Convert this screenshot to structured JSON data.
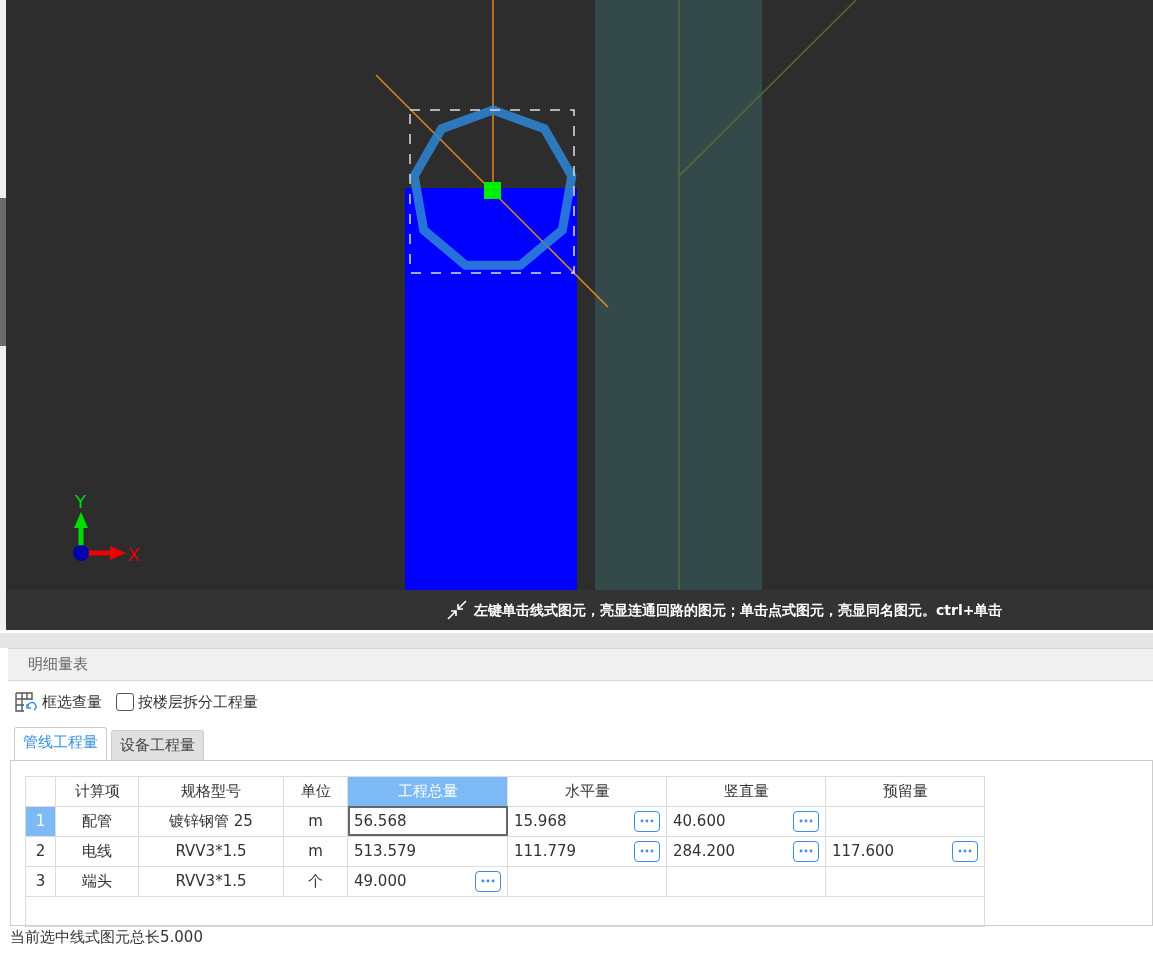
{
  "canvas": {
    "axis": {
      "x_label": "X",
      "y_label": "Y"
    },
    "hint": "左键单击线式图元，亮显连通回路的图元；单击点式图元，亮显同名图元。ctrl+单击"
  },
  "panel": {
    "title": "明细量表",
    "tool": "框选查量",
    "split_by_floor": {
      "label": "按楼层拆分工程量",
      "checked": false
    },
    "tabs": [
      {
        "label": "管线工程量",
        "selected": true
      },
      {
        "label": "设备工程量",
        "selected": false
      }
    ],
    "table": {
      "columns": [
        {
          "label": "计算项",
          "selected": false
        },
        {
          "label": "规格型号",
          "selected": false
        },
        {
          "label": "单位",
          "selected": false
        },
        {
          "label": "工程总量",
          "selected": true
        },
        {
          "label": "水平量",
          "selected": false
        },
        {
          "label": "竖直量",
          "selected": false
        },
        {
          "label": "预留量",
          "selected": false
        }
      ],
      "rows": [
        {
          "number": "1",
          "selected": true,
          "cells": [
            {
              "text": "配管",
              "more": false,
              "focused": false
            },
            {
              "text": "镀锌钢管 25",
              "more": false,
              "focused": false
            },
            {
              "text": "m",
              "more": false,
              "focused": false
            },
            {
              "text": "56.568",
              "more": false,
              "focused": true
            },
            {
              "text": "15.968",
              "more": true,
              "focused": false
            },
            {
              "text": "40.600",
              "more": true,
              "focused": false
            },
            {
              "more": false,
              "focused": false
            }
          ]
        },
        {
          "number": "2",
          "selected": false,
          "cells": [
            {
              "text": "电线",
              "more": false,
              "focused": false
            },
            {
              "text": "RVV3*1.5",
              "more": false,
              "focused": false
            },
            {
              "text": "m",
              "more": false,
              "focused": false
            },
            {
              "text": "513.579",
              "more": false,
              "focused": false
            },
            {
              "text": "111.779",
              "more": true,
              "focused": false
            },
            {
              "text": "284.200",
              "more": true,
              "focused": false
            },
            {
              "text": "117.600",
              "more": true,
              "focused": false
            }
          ]
        },
        {
          "number": "3",
          "selected": false,
          "cells": [
            {
              "text": "端头",
              "more": false,
              "focused": false
            },
            {
              "text": "RVV3*1.5",
              "more": false,
              "focused": false
            },
            {
              "text": "个",
              "more": false,
              "focused": false
            },
            {
              "text": "49.000",
              "more": true,
              "focused": false
            },
            {
              "more": false,
              "focused": false
            },
            {
              "more": false,
              "focused": false
            },
            {
              "more": false,
              "focused": false
            }
          ]
        }
      ]
    },
    "status": "当前选中线式图元总长5.000"
  }
}
